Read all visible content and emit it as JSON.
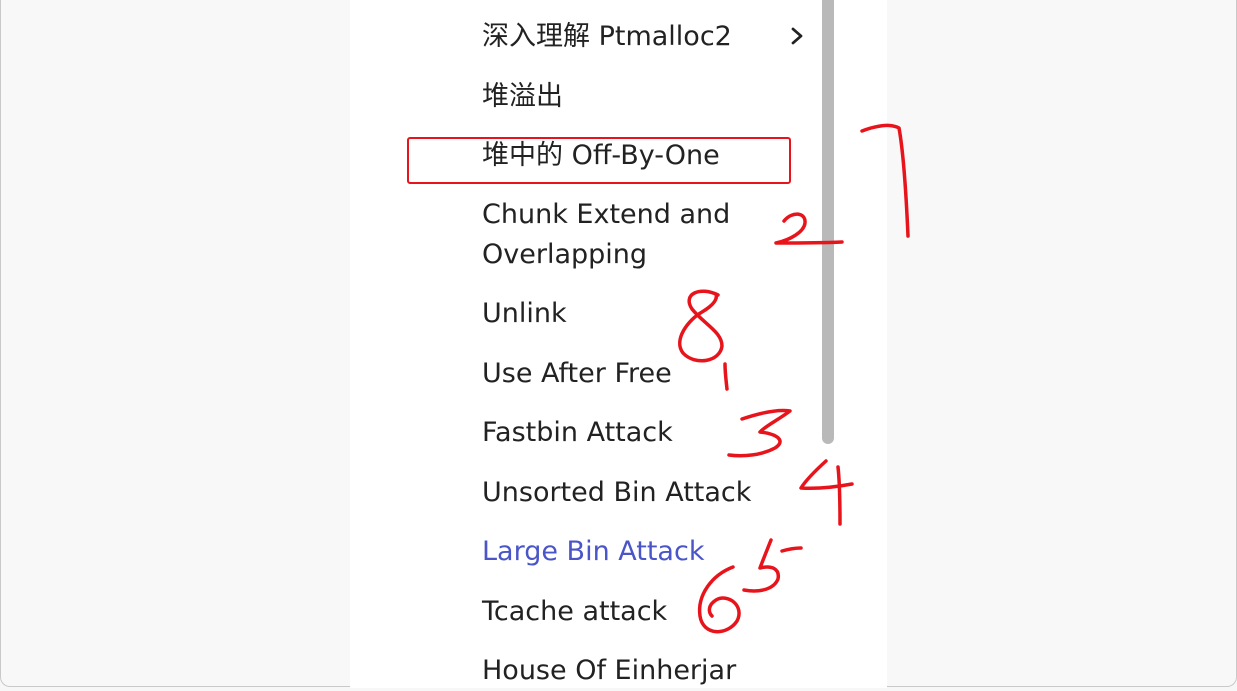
{
  "nav": {
    "items": [
      {
        "label": "深入理解 Ptmalloc2",
        "has_submenu": true
      },
      {
        "label": "堆溢出"
      },
      {
        "label": "堆中的 Off-By-One",
        "highlighted": true
      },
      {
        "label": "Chunk Extend and",
        "label_line2": "Overlapping"
      },
      {
        "label": "Unlink"
      },
      {
        "label": "Use After Free"
      },
      {
        "label": "Fastbin Attack"
      },
      {
        "label": "Unsorted Bin Attack"
      },
      {
        "label": "Large Bin Attack",
        "active": true
      },
      {
        "label": "Tcache attack"
      },
      {
        "label": "House Of Einherjar"
      }
    ]
  },
  "annotations": {
    "color": "#e8141c",
    "marks": [
      "7",
      "2",
      "8",
      "1",
      "3",
      "4",
      "5",
      "6"
    ]
  },
  "colors": {
    "text": "#222222",
    "active_link": "#4a55c7",
    "highlight_border": "#e8141c"
  }
}
